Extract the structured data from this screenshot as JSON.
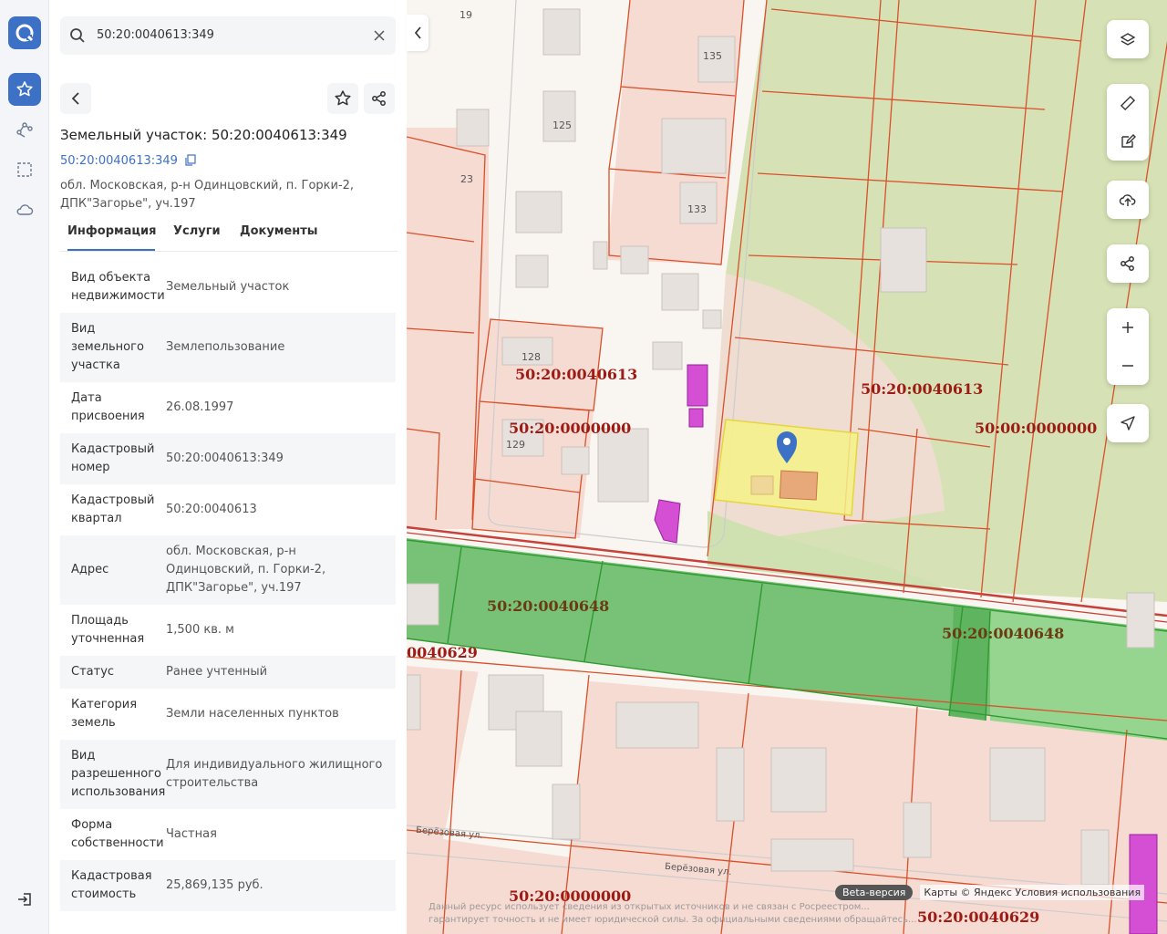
{
  "search": {
    "value": "50:20:0040613:349"
  },
  "object": {
    "title": "Земельный участок: 50:20:0040613:349",
    "cad_link": "50:20:0040613:349",
    "address_line1": "обл. Московская, р-н Одинцовский, п. Горки-2,",
    "address_line2": "ДПК\"Загорье\", уч.197"
  },
  "tabs": [
    "Информация",
    "Услуги",
    "Документы"
  ],
  "info_rows": [
    {
      "k1": "Вид объекта",
      "k2": "недвижимости",
      "k3": "",
      "v1": "Земельный участок",
      "v2": "",
      "v3": ""
    },
    {
      "k1": "Вид",
      "k2": "земельного",
      "k3": "участка",
      "v1": "Землепользование",
      "v2": "",
      "v3": ""
    },
    {
      "k1": "Дата",
      "k2": "присвоения",
      "k3": "",
      "v1": "26.08.1997",
      "v2": "",
      "v3": ""
    },
    {
      "k1": "Кадастровый",
      "k2": "номер",
      "k3": "",
      "v1": "50:20:0040613:349",
      "v2": "",
      "v3": ""
    },
    {
      "k1": "Кадастровый",
      "k2": "квартал",
      "k3": "",
      "v1": "50:20:0040613",
      "v2": "",
      "v3": ""
    },
    {
      "k1": "Адрес",
      "k2": "",
      "k3": "",
      "v1": "обл. Московская, р-н",
      "v2": "Одинцовский, п. Горки-2,",
      "v3": "ДПК\"Загорье\", уч.197"
    },
    {
      "k1": "Площадь",
      "k2": "уточненная",
      "k3": "",
      "v1": "1,500 кв. м",
      "v2": "",
      "v3": ""
    },
    {
      "k1": "Статус",
      "k2": "",
      "k3": "",
      "v1": "Ранее учтенный",
      "v2": "",
      "v3": ""
    },
    {
      "k1": "Категория",
      "k2": "земель",
      "k3": "",
      "v1": "Земли населенных пунктов",
      "v2": "",
      "v3": ""
    },
    {
      "k1": "Вид",
      "k2": "разрешенного",
      "k3": "использования",
      "v1": "Для индивидуального жилищного",
      "v2": "строительства",
      "v3": ""
    },
    {
      "k1": "Форма",
      "k2": "собственности",
      "k3": "",
      "v1": "Частная",
      "v2": "",
      "v3": ""
    },
    {
      "k1": "Кадастровая",
      "k2": "стоимость",
      "k3": "",
      "v1": "25,869,135 руб.",
      "v2": "",
      "v3": ""
    }
  ],
  "map": {
    "quarters": {
      "q1": "50:20:0040613",
      "q2": "50:20:0040613",
      "q3": "50:20:0000000",
      "q4": "50:00:0000000",
      "q5": "50:20:0040648",
      "q6": "50:20:0040648",
      "q7": "0040629",
      "q8": "50:20:0000000",
      "q9": "50:20:0040629"
    },
    "houses": {
      "h19": "19",
      "h135": "135",
      "h125": "125",
      "h23": "23",
      "h133": "133",
      "h128": "128",
      "h129": "129"
    },
    "streets": {
      "s1": "Берёзовая ул.",
      "s2": "Берёзовая ул."
    },
    "beta": "Beta-версия",
    "attribution": "Карты © Яндекс  Условия использования",
    "disclaimer1": "Данный ресурс использует сведения из открытых источников и не связан с Росреестром...",
    "disclaimer2": "гарантирует точность и не имеет юридической силы. За официальными сведениями обращайтесь..."
  },
  "colors": {
    "accent": "#3d71c6",
    "parcel_line": "#d9502a",
    "selected": "#f6f28a",
    "green_zone": "#7fc77f"
  },
  "icons": [
    "logo-icon",
    "star-icon",
    "route-icon",
    "select-area-icon",
    "cloud-icon",
    "logout-icon",
    "search-icon",
    "close-icon",
    "back-icon",
    "share-icon",
    "copy-icon",
    "layers-icon",
    "ruler-icon",
    "edit-icon",
    "upload-icon",
    "plus-icon",
    "minus-icon",
    "locate-icon",
    "chevron-left-icon",
    "map-pin-icon"
  ]
}
